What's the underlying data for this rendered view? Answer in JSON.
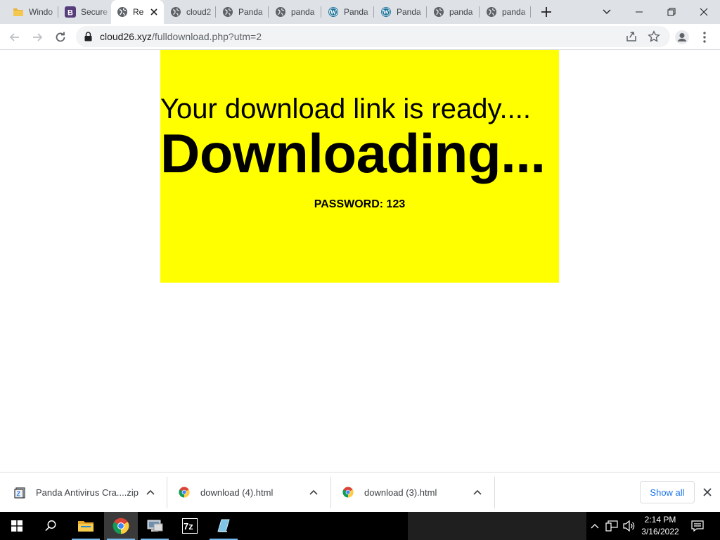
{
  "browser": {
    "tabs": [
      {
        "label": "Windo",
        "icon": "folder-icon",
        "active": false
      },
      {
        "label": "Secure",
        "icon": "bootstrap-icon",
        "active": false
      },
      {
        "label": "Re",
        "icon": "globe-icon",
        "active": true
      },
      {
        "label": "cloud2",
        "icon": "globe-icon",
        "active": false
      },
      {
        "label": "Panda",
        "icon": "globe-icon",
        "active": false
      },
      {
        "label": "panda",
        "icon": "globe-icon",
        "active": false
      },
      {
        "label": "Panda",
        "icon": "wordpress-icon",
        "active": false
      },
      {
        "label": "Panda",
        "icon": "wordpress-icon",
        "active": false
      },
      {
        "label": "panda",
        "icon": "globe-icon",
        "active": false
      },
      {
        "label": "panda",
        "icon": "globe-icon",
        "active": false
      }
    ],
    "url_host": "cloud26.xyz",
    "url_path": "/fulldownload.php?utm=2"
  },
  "page": {
    "ready_text": "Your download link is ready....",
    "downloading_text": "Downloading...",
    "password_text": "PASSWORD: 123",
    "banner_color": "#ffff00"
  },
  "downloads": {
    "items": [
      {
        "name": "Panda Antivirus Cra....zip",
        "icon": "zip-archive-icon"
      },
      {
        "name": "download (4).html",
        "icon": "chrome-icon"
      },
      {
        "name": "download (3).html",
        "icon": "chrome-icon"
      }
    ],
    "show_all_label": "Show all"
  },
  "taskbar": {
    "time": "2:14 PM",
    "date": "3/16/2022"
  }
}
